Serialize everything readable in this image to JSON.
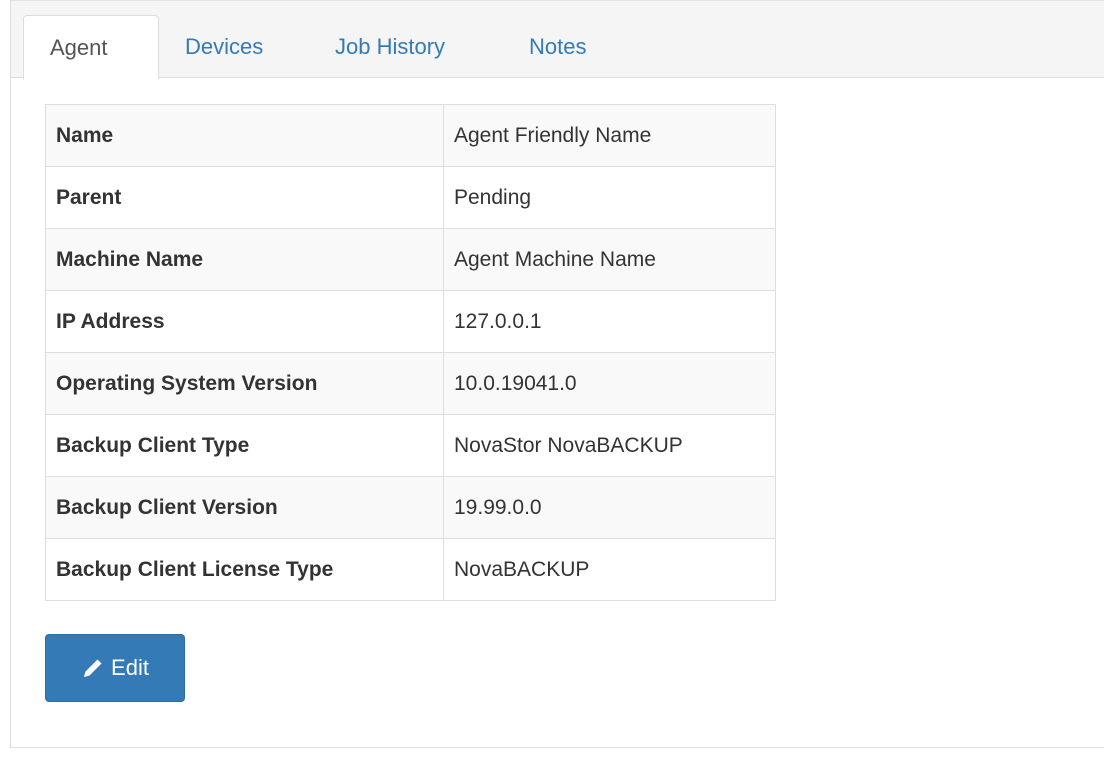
{
  "tabs": [
    {
      "label": "Agent",
      "active": true
    },
    {
      "label": "Devices",
      "active": false
    },
    {
      "label": "Job History",
      "active": false
    },
    {
      "label": "Notes",
      "active": false
    }
  ],
  "agent_info": {
    "rows": [
      {
        "label": "Name",
        "value": "Agent Friendly Name"
      },
      {
        "label": "Parent",
        "value": "Pending"
      },
      {
        "label": "Machine Name",
        "value": "Agent Machine Name"
      },
      {
        "label": "IP Address",
        "value": "127.0.0.1"
      },
      {
        "label": "Operating System Version",
        "value": "10.0.19041.0"
      },
      {
        "label": "Backup Client Type",
        "value": "NovaStor NovaBACKUP"
      },
      {
        "label": "Backup Client Version",
        "value": "19.99.0.0"
      },
      {
        "label": "Backup Client License Type",
        "value": "NovaBACKUP"
      }
    ]
  },
  "actions": {
    "edit_label": "Edit",
    "edit_icon": "pencil-icon"
  },
  "colors": {
    "primary": "#337ab7",
    "link": "#337ab7",
    "border": "#dddddd",
    "stripe": "#f9f9f9"
  }
}
